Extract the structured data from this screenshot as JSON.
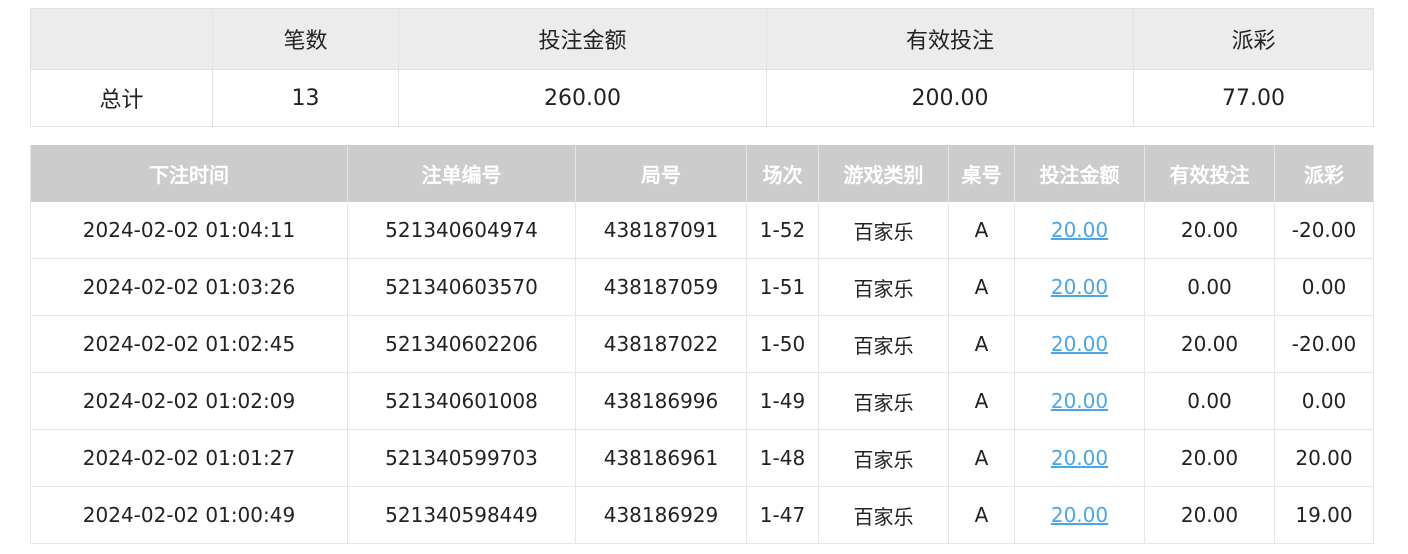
{
  "summary": {
    "headers": [
      "",
      "笔数",
      "投注金额",
      "有效投注",
      "派彩"
    ],
    "total": {
      "label": "总计",
      "count": "13",
      "bet_amount": "260.00",
      "valid_bet": "200.00",
      "payout": "77.00"
    }
  },
  "detail": {
    "headers": [
      "下注时间",
      "注单编号",
      "局号",
      "场次",
      "游戏类别",
      "桌号",
      "投注金额",
      "有效投注",
      "派彩"
    ],
    "rows": [
      {
        "time": "2024-02-02 01:04:11",
        "bet_id": "521340604974",
        "round": "438187091",
        "session": "1-52",
        "game": "百家乐",
        "table": "A",
        "bet": "20.00",
        "valid": "20.00",
        "payout": "-20.00",
        "negative": true
      },
      {
        "time": "2024-02-02 01:03:26",
        "bet_id": "521340603570",
        "round": "438187059",
        "session": "1-51",
        "game": "百家乐",
        "table": "A",
        "bet": "20.00",
        "valid": "0.00",
        "payout": "0.00",
        "negative": false
      },
      {
        "time": "2024-02-02 01:02:45",
        "bet_id": "521340602206",
        "round": "438187022",
        "session": "1-50",
        "game": "百家乐",
        "table": "A",
        "bet": "20.00",
        "valid": "20.00",
        "payout": "-20.00",
        "negative": true
      },
      {
        "time": "2024-02-02 01:02:09",
        "bet_id": "521340601008",
        "round": "438186996",
        "session": "1-49",
        "game": "百家乐",
        "table": "A",
        "bet": "20.00",
        "valid": "0.00",
        "payout": "0.00",
        "negative": false
      },
      {
        "time": "2024-02-02 01:01:27",
        "bet_id": "521340599703",
        "round": "438186961",
        "session": "1-48",
        "game": "百家乐",
        "table": "A",
        "bet": "20.00",
        "valid": "20.00",
        "payout": "20.00",
        "negative": false
      },
      {
        "time": "2024-02-02 01:00:49",
        "bet_id": "521340598449",
        "round": "438186929",
        "session": "1-47",
        "game": "百家乐",
        "table": "A",
        "bet": "20.00",
        "valid": "20.00",
        "payout": "19.00",
        "negative": false
      }
    ]
  },
  "colors": {
    "negative": "#e84a5f",
    "link": "#4aa6e6",
    "header_bg": "#cccccc"
  }
}
